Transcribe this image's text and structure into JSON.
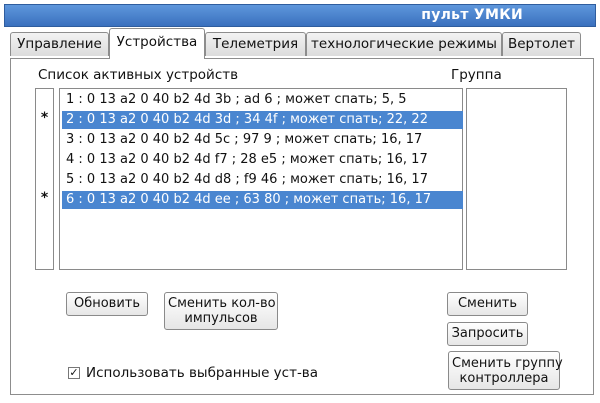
{
  "window": {
    "title": "пульт УМКИ"
  },
  "tabs": [
    {
      "label": "Управление",
      "active": false
    },
    {
      "label": "Устройства",
      "active": true
    },
    {
      "label": "Телеметрия",
      "active": false
    },
    {
      "label": "технологические режимы",
      "active": false
    },
    {
      "label": "Вертолет",
      "active": false
    }
  ],
  "devices": {
    "header": "Список активных устройств",
    "rows": [
      {
        "text": "1 : 0 13 a2 0 40 b2 4d 3b ; ad 6 ; может спать; 5, 5",
        "selected": false,
        "mark": ""
      },
      {
        "text": "2 : 0 13 a2 0 40 b2 4d 3d ; 34 4f ; может спать; 22, 22",
        "selected": true,
        "mark": "*"
      },
      {
        "text": "3 : 0 13 a2 0 40 b2 4d 5c ; 97 9 ; может спать; 16, 17",
        "selected": false,
        "mark": ""
      },
      {
        "text": "4 : 0 13 a2 0 40 b2 4d f7 ; 28 e5 ; может спать; 16, 17",
        "selected": false,
        "mark": ""
      },
      {
        "text": "5 : 0 13 a2 0 40 b2 4d d8 ; f9 46 ; может спать; 16, 17",
        "selected": false,
        "mark": ""
      },
      {
        "text": "6 : 0 13 a2 0 40 b2 4d ee ; 63 80 ; может спать; 16, 17",
        "selected": true,
        "mark": "*"
      }
    ]
  },
  "group": {
    "header": "Группа"
  },
  "buttons": {
    "refresh": "Обновить",
    "change_pulses": [
      "Сменить кол-во",
      "импульсов"
    ],
    "change": "Сменить",
    "request": "Запросить",
    "change_group": [
      "Сменить группу",
      "контроллера"
    ]
  },
  "checkbox": {
    "label": "Использовать выбранные уст-ва",
    "checked": true,
    "mark": "✓"
  }
}
